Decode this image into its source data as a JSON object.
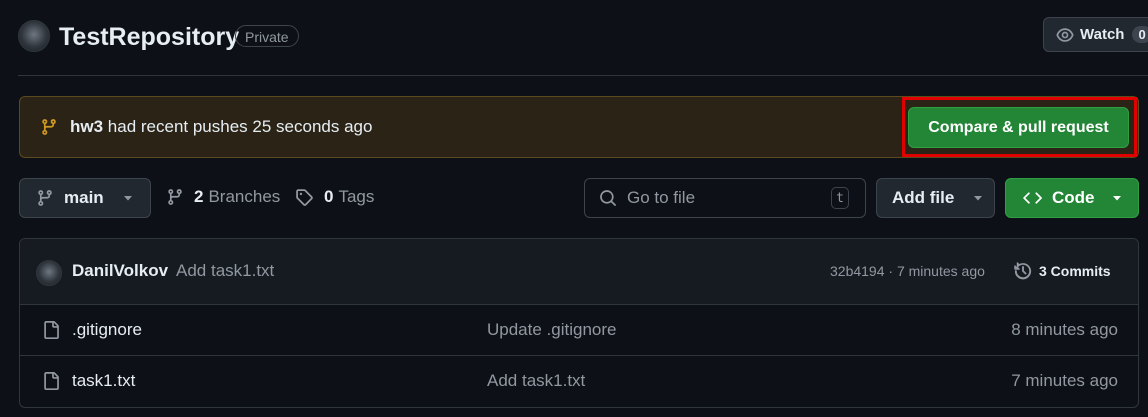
{
  "header": {
    "repo_name": "TestRepository",
    "visibility_badge": "Private",
    "watch": {
      "label": "Watch",
      "count": "0"
    }
  },
  "push_banner": {
    "branch": "hw3",
    "message": "had recent pushes 25 seconds ago",
    "compare_button": "Compare & pull request"
  },
  "toolbar": {
    "branch_select": "main",
    "branches": {
      "count": "2",
      "label": "Branches"
    },
    "tags": {
      "count": "0",
      "label": "Tags"
    },
    "search": {
      "placeholder": "Go to file",
      "value": "",
      "shortcut": "t"
    },
    "add_file": "Add file",
    "code": "Code"
  },
  "latest_commit": {
    "author": "DanilVolkov",
    "message": "Add task1.txt",
    "meta": "32b4194 · 7 minutes ago",
    "commits_link": "3 Commits"
  },
  "files": [
    {
      "name": ".gitignore",
      "commit_message": "Update .gitignore",
      "time": "8 minutes ago"
    },
    {
      "name": "task1.txt",
      "commit_message": "Add task1.txt",
      "time": "7 minutes ago"
    }
  ],
  "colors": {
    "background": "#0d1117",
    "primary_green": "#238636",
    "banner_bg": "#2b2416",
    "highlight_red": "#e00000",
    "muted_text": "#9198a1"
  },
  "icons": [
    "branch-icon",
    "tag-icon",
    "search-icon",
    "eye-icon",
    "code-icon",
    "history-icon",
    "file-icon",
    "chevron-down-icon"
  ]
}
